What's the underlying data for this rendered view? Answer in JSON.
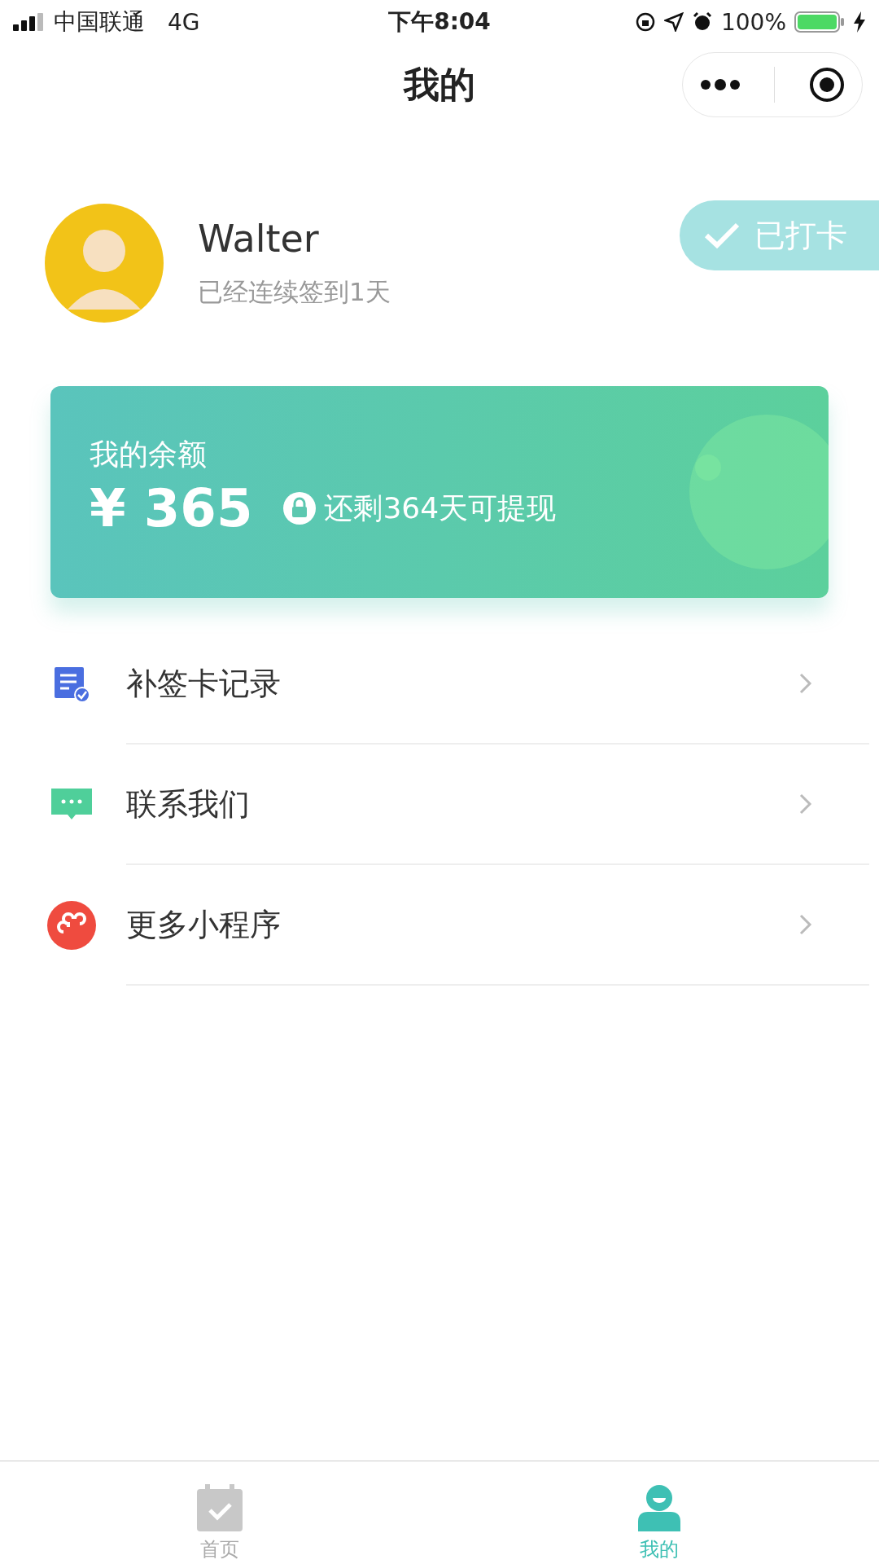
{
  "status_bar": {
    "carrier": "中国联通",
    "network": "4G",
    "time": "下午8:04",
    "battery": "100%"
  },
  "nav": {
    "title": "我的"
  },
  "profile": {
    "name": "Walter",
    "streak": "已经连续签到1天",
    "checkin": {
      "label": "已打卡",
      "checked": true
    }
  },
  "balance": {
    "label": "我的余额",
    "amount": "¥ 365",
    "note": "还剩364天可提现"
  },
  "menu": [
    {
      "kind": "record",
      "label": "补签卡记录"
    },
    {
      "kind": "contact",
      "label": "联系我们"
    },
    {
      "kind": "more",
      "label": "更多小程序"
    }
  ],
  "tabs": [
    {
      "kind": "home",
      "label": "首页",
      "selected": false
    },
    {
      "kind": "mine",
      "label": "我的",
      "selected": true
    }
  ]
}
